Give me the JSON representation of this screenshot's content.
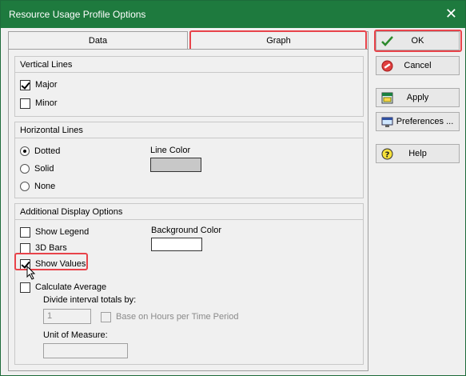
{
  "window": {
    "title": "Resource Usage Profile Options",
    "close_glyph": "✕"
  },
  "tabs": [
    {
      "label": "Data"
    },
    {
      "label": "Graph"
    }
  ],
  "vertical_lines": {
    "header": "Vertical Lines",
    "major": {
      "label": "Major",
      "checked": true
    },
    "minor": {
      "label": "Minor",
      "checked": false
    }
  },
  "horizontal_lines": {
    "header": "Horizontal Lines",
    "options": [
      {
        "label": "Dotted",
        "selected": true
      },
      {
        "label": "Solid",
        "selected": false
      },
      {
        "label": "None",
        "selected": false
      }
    ],
    "line_color_label": "Line Color",
    "line_color": "#c8c8c8"
  },
  "additional": {
    "header": "Additional Display Options",
    "show_legend": {
      "label": "Show Legend",
      "checked": false
    },
    "bars_3d": {
      "label": "3D Bars",
      "checked": false
    },
    "show_values": {
      "label": "Show Values",
      "checked": true
    },
    "calculate_average": {
      "label": "Calculate Average",
      "checked": false
    },
    "background_color_label": "Background Color",
    "background_color": "#ffffff",
    "divide_label": "Divide interval totals by:",
    "divide_value": "1",
    "base_on_hours": {
      "label": "Base on Hours per Time Period",
      "checked": false
    },
    "unit_label": "Unit of Measure:",
    "unit_value": ""
  },
  "buttons": {
    "ok": "OK",
    "cancel": "Cancel",
    "apply": "Apply",
    "preferences": "Preferences ...",
    "help": "Help"
  },
  "colors": {
    "titlebar": "#1e7a3e",
    "highlight": "#e8434a"
  }
}
